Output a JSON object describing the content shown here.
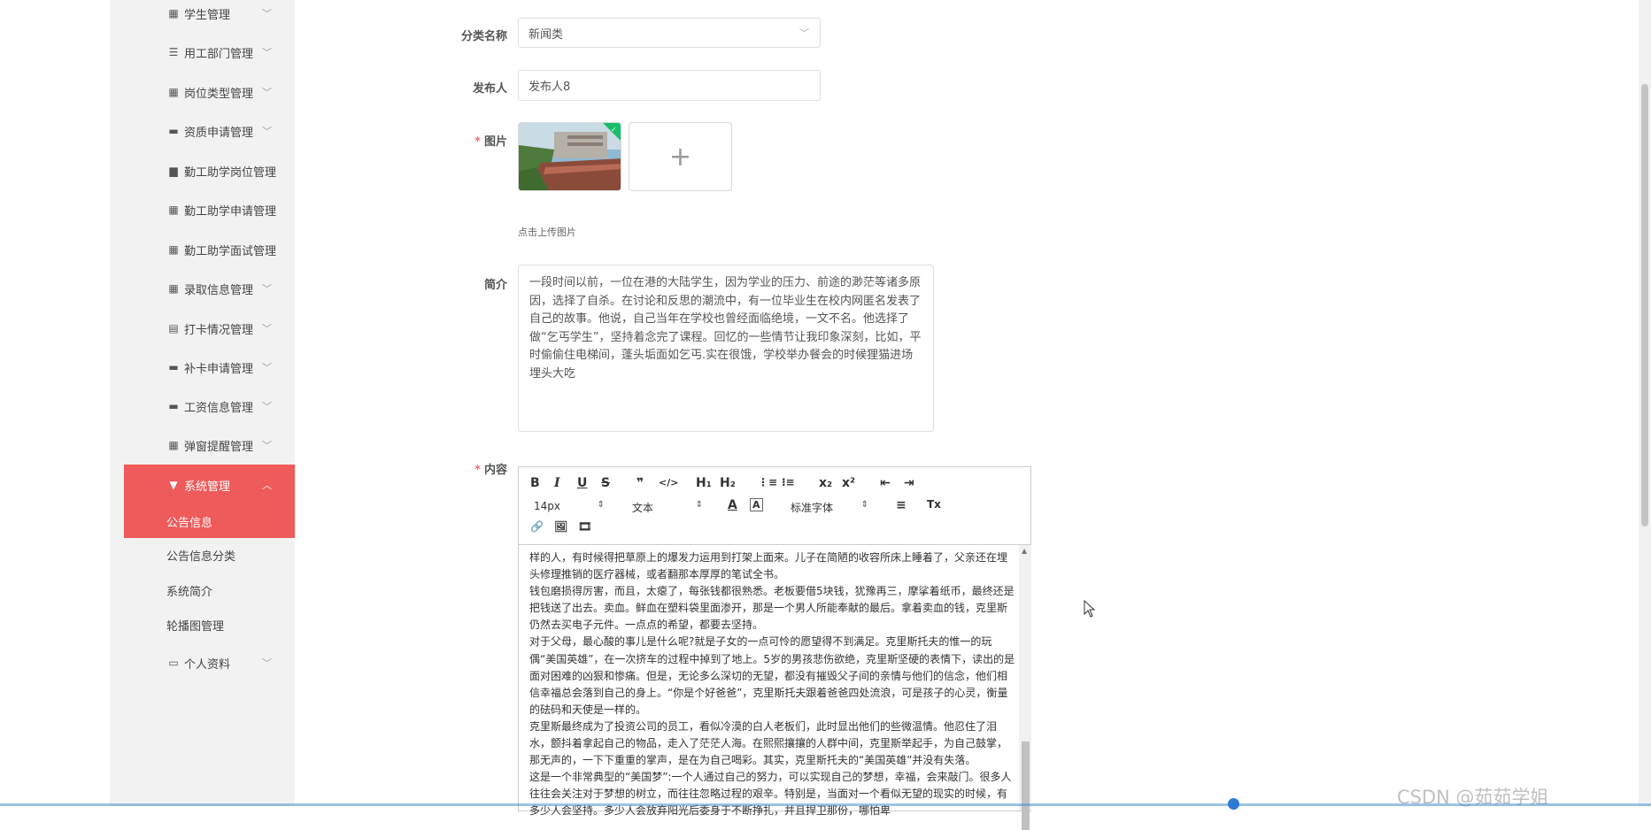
{
  "sidebar": {
    "items": [
      {
        "icon": "grid-icon",
        "glyph": "▦",
        "label": "学生管理",
        "chevron": "﹀"
      },
      {
        "icon": "sliders-icon",
        "glyph": "☰",
        "label": "用工部门管理",
        "chevron": "﹀"
      },
      {
        "icon": "grid-icon",
        "glyph": "▦",
        "label": "岗位类型管理",
        "chevron": "﹀"
      },
      {
        "icon": "briefcase-icon",
        "glyph": "▬",
        "label": "资质申请管理",
        "chevron": "﹀"
      },
      {
        "icon": "chat-icon",
        "glyph": "▆",
        "label": "勤工助学岗位管理",
        "chevron": ""
      },
      {
        "icon": "grid-icon",
        "glyph": "▦",
        "label": "勤工助学申请管理",
        "chevron": ""
      },
      {
        "icon": "grid-icon",
        "glyph": "▦",
        "label": "勤工助学面试管理",
        "chevron": ""
      },
      {
        "icon": "grid-icon",
        "glyph": "▦",
        "label": "录取信息管理",
        "chevron": "﹀"
      },
      {
        "icon": "clipboard-icon",
        "glyph": "▤",
        "label": "打卡情况管理",
        "chevron": "﹀"
      },
      {
        "icon": "monitor-icon",
        "glyph": "▬",
        "label": "补卡申请管理",
        "chevron": "﹀"
      },
      {
        "icon": "message-icon",
        "glyph": "▬",
        "label": "工资信息管理",
        "chevron": "﹀"
      },
      {
        "icon": "grid-icon",
        "glyph": "▦",
        "label": "弹窗提醒管理",
        "chevron": "﹀"
      },
      {
        "icon": "cup-icon",
        "glyph": "▼",
        "label": "系统管理",
        "chevron": "︿"
      }
    ],
    "subitems": [
      "公告信息",
      "公告信息分类",
      "系统简介",
      "轮播图管理"
    ],
    "profile": {
      "icon": "id-card-icon",
      "glyph": "▭",
      "label": "个人资料",
      "chevron": "﹀"
    }
  },
  "form": {
    "category": {
      "label": "分类名称",
      "value": "新闻类"
    },
    "publisher": {
      "label": "发布人",
      "value": "发布人8"
    },
    "image": {
      "label": "图片",
      "required_mark": "*",
      "upload_plus": "+",
      "hint": "点击上传图片"
    },
    "summary": {
      "label": "简介",
      "value": "一段时间以前，一位在港的大陆学生，因为学业的压力、前途的渺茫等诸多原因，选择了自杀。在讨论和反思的潮流中，有一位毕业生在校内网匿名发表了自己的故事。他说，自己当年在学校也曾经面临绝境，一文不名。他选择了做“乞丐学生”，坚持着念完了课程。回忆的一些情节让我印象深刻，比如，平时偷偷住电梯间，蓬头垢面如乞丐.实在很饿，学校举办餐会的时候狸猫进场埋头大吃"
    },
    "content": {
      "label": "内容",
      "required_mark": "*"
    }
  },
  "editor": {
    "toolbar": {
      "bold": "B",
      "italic": "I",
      "underline": "U",
      "strike": "S",
      "quote": "❞",
      "code": "</>",
      "h1": "H₁",
      "h2": "H₂",
      "ordered_list": "⋮≡",
      "bullet_list": "⁝≡",
      "subscript": "x₂",
      "superscript": "x²",
      "outdent": "⇤",
      "indent": "⇥",
      "size": "14px",
      "format": "文本",
      "color": "A",
      "background": "A",
      "font": "标准字体",
      "align": "≡",
      "clear": "Tx",
      "link": "🔗",
      "image": "🖼",
      "video": "🎞"
    },
    "paragraphs": [
      "样的人，有时候得把草原上的爆发力运用到打架上面来。儿子在简陋的收容所床上睡着了，父亲还在埋头修理推销的医疗器械，或者翻那本厚厚的笔试全书。",
      "钱包磨损得厉害，而且，太瘪了，每张钱都很熟悉。老板要借5块钱，犹豫再三，摩挲着纸币，最终还是把钱送了出去。卖血。鲜血在塑料袋里面渗开，那是一个男人所能奉献的最后。拿着卖血的钱，克里斯仍然去买电子元件。一点点的希望，都要去坚持。",
      "对于父母，最心酸的事儿是什么呢?就是子女的一点可怜的愿望得不到满足。克里斯托夫的惟一的玩偶“美国英雄”，在一次挤车的过程中掉到了地上。5岁的男孩悲伤欲绝，克里斯坚硬的表情下，读出的是面对困难的凶狠和惨痛。但是，无论多么深切的无望，都没有摧毁父子间的亲情与他们的信念，他们相信幸福总会落到自己的身上。“你是个好爸爸”，克里斯托夫跟着爸爸四处流浪，可是孩子的心灵，衡量的砝码和天使是一样的。",
      "克里斯最终成为了投资公司的员工，看似冷漠的白人老板们，此时显出他们的些微温情。他忍住了泪水，颤抖着拿起自己的物品，走入了茫茫人海。在熙熙攘攘的人群中间，克里斯举起手，为自己鼓掌，那无声的，一下下重重的掌声，是在为自己喝彩。其实，克里斯托夫的“美国英雄”并没有失落。",
      "这是一个非常典型的“美国梦”:一个人通过自己的努力，可以实现自己的梦想，幸福，会来敲门。很多人往往会关注对于梦想的树立，而往往忽略过程的艰辛。特别是，当面对一个看似无望的现实的时候，有多少人会坚持。多少人会放弃阳光后委身于不断挣扎，并且捍卫那份，哪怕卑"
    ],
    "scroll_up": "▲"
  },
  "watermark": "CSDN @茹茹学姐",
  "colors": {
    "accent": "#ef5a5a",
    "required": "#f56c6c"
  }
}
